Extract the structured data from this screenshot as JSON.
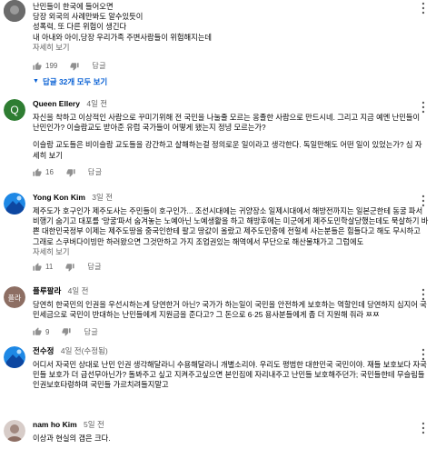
{
  "comments": [
    {
      "author": "",
      "time": "",
      "lines": [
        "난민들이 한국에 들어오면",
        "당장 외국의 사례만봐도 알수있듯이",
        "성폭력, 또 다른 위험이 생긴다",
        "내 아내와 아이,당장 우리가족 주변사람들이 위험해지는데"
      ],
      "more": "자세히 보기",
      "likes": "199",
      "reply": "답글",
      "replies_label": "답글 32개 모두 보기"
    },
    {
      "author": "Queen Ellery",
      "time": "4일 전",
      "avatar_letter": "Q",
      "avatar_color": "#2e7d32",
      "lines": [
        "자신을 착하고 이상적인 사람으로 꾸미기위해 전 국민을 나눌줄 모르는 옹졸한 사람으로 만드시네. 그리고 지금 예멘 난민들이 난민인가? 이슬람교도 받아준 유럽 국가들이 어떻게 됐는지 정녕 모르는가?",
        "",
        "이슬람 교도들은 비이슬람 교도들을 강간하고 살해하는걸 정의로운 일이라고 생각한다. 독일만해도 어떤 일이 있었는가? 심 자세히 보기"
      ],
      "more": "",
      "likes": "16",
      "reply": "답글"
    },
    {
      "author": "Yong Kon Kim",
      "time": "3일 전",
      "avatar_letter": "",
      "avatar_color": "#3a6fd8",
      "lines": [
        "제주도가 호구인가 제주도사는 주민들이 호구인가... 조선시대에는 귀양장소 일제시대에서 해방전까지는 일본군한테 동굴 파서 비행기 숨기고 대포를 '망굴'파서 숨겨놓는 노예아닌 노예생활을 하고 해방후에는 미군에게 제주도민학살당했는데도 묵살하기 바쁜 대한민국정부 이제는 제주도땅을 중국인한테 팔고 땅값이 올랐고 제주도민중에 전혈세 사는분들은 힘들다고 해도 무시하고 그래로 스쿠버다이빙만 하러왔으면 그것만하고 가지 조업권있는 해역에서 무단으로 해산물채가고 그럽에도"
      ],
      "more": "자세히 보기",
      "likes": "11",
      "reply": "답글"
    },
    {
      "author": "플루팔라",
      "time": "4일 전",
      "avatar_letter": "플라",
      "avatar_color": "#8d6e63",
      "lines": [
        "당연히 한국민의 인권을 우선시하는게 당연한거 아닌? 국가가 하는일이 국민을 안전하게 보호하는 역할인데 당연하지 심지어 국민세금으로 국민이 반대하는 난민들에게 지원금을 준다고? 그 돈으로 6·25 용사분들에게 좀 더 지원해 줘라 ㅉㅉ"
      ],
      "more": "",
      "likes": "9",
      "reply": "답글"
    },
    {
      "author": "전수정",
      "time": "4일 전(수정됨)",
      "avatar_letter": "",
      "avatar_color": "#3a6fd8",
      "lines": [
        "어디서 자국민 상대로 난민 인권 생각해달라니 수용해달라니 개별소리야. 우리도 평범한 대한민국 국민이야. 재들 보호보다 자국민들 보호가 더 급선무아닌가? 돌봐주고 싶고 지켜주고싶으면 본인집에 자리내주고 난민들 보호해주던가; 국민들한테 무슬림들 인권보호타령하며 국민들 가르치려들지말고"
      ],
      "more": "",
      "likes": "",
      "reply": ""
    },
    {
      "author": "nam ho Kim",
      "time": "5일 전",
      "avatar_letter": "",
      "avatar_color": "#c9b8a0",
      "lines": [
        "이상과 현실의 갭은 크다."
      ],
      "more": "",
      "likes": "",
      "reply": ""
    }
  ]
}
